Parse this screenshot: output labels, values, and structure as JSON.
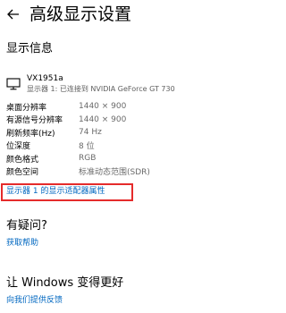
{
  "header": {
    "title": "高级显示设置"
  },
  "display_info": {
    "section_title": "显示信息",
    "monitor": {
      "name": "VX1951a",
      "description": "显示器 1: 已连接到 NVIDIA GeForce GT 730"
    },
    "rows": [
      {
        "label": "桌面分辨率",
        "value": "1440 × 900"
      },
      {
        "label": "有源信号分辨率",
        "value": "1440 × 900"
      },
      {
        "label": "刷新频率(Hz)",
        "value": "74 Hz"
      },
      {
        "label": "位深度",
        "value": "8 位"
      },
      {
        "label": "颜色格式",
        "value": "RGB"
      },
      {
        "label": "颜色空间",
        "value": "标准动态范围(SDR)"
      }
    ],
    "adapter_link": "显示器 1 的显示适配器属性",
    "highlight_color": "#e52b2b"
  },
  "help": {
    "title": "有疑问?",
    "link": "获取帮助"
  },
  "feedback": {
    "title": "让 Windows 变得更好",
    "link": "向我们提供反馈"
  },
  "colors": {
    "link": "#0067c0",
    "secondary_text": "#6a6a6a"
  }
}
